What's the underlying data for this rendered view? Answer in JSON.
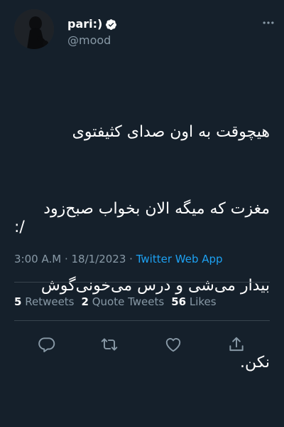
{
  "user": {
    "display_name": "pari:)",
    "handle": "@mood"
  },
  "tweet": {
    "lines": [
      "هیچوقت به اون صدای کثیفتوی",
      "مغزت که میگه الان بخواب صبح‌زود",
      "بیدار می‌شی و درس می‌خونی‌گوش",
      "نکن."
    ],
    "emoticon": ":/",
    "time": "3:00 A.M",
    "date": "18/1/2023",
    "source": "Twitter Web App",
    "separator": " · "
  },
  "stats": {
    "retweets_count": "5",
    "retweets_label": "Retweets",
    "quotes_count": "2",
    "quotes_label": "Quote Tweets",
    "likes_count": "56",
    "likes_label": "Likes"
  },
  "colors": {
    "background": "#15202b",
    "text": "#ffffff",
    "muted": "#8899a6",
    "link": "#1da1f2",
    "divider": "#38444d"
  },
  "icons": {
    "verified": "verified-badge-icon",
    "more": "more-horizontal-icon",
    "reply": "reply-icon",
    "retweet": "retweet-icon",
    "like": "heart-icon",
    "share": "share-icon"
  }
}
